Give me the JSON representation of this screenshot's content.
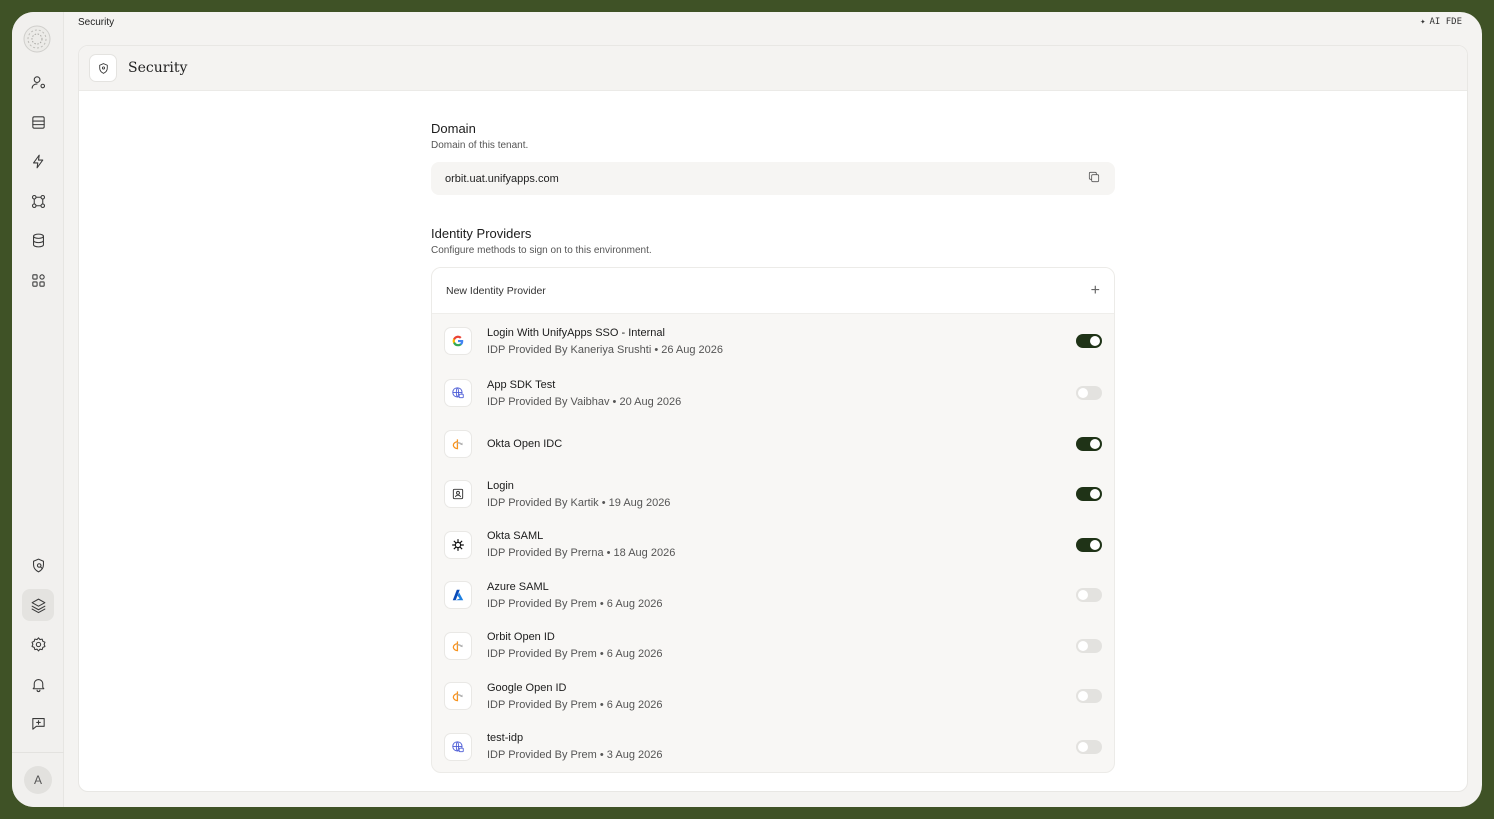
{
  "window": {
    "breadcrumb": "Security",
    "ai_label": "AI FDE"
  },
  "page": {
    "title": "Security"
  },
  "domain": {
    "title": "Domain",
    "subtitle": "Domain of this tenant.",
    "value": "orbit.uat.unifyapps.com"
  },
  "identity_providers": {
    "title": "Identity Providers",
    "subtitle": "Configure methods to sign on to this environment.",
    "new_label": "New Identity Provider",
    "items": [
      {
        "name": "Login With UnifyApps SSO - Internal",
        "meta": "IDP Provided By Kaneriya Srushti • 26 Aug 2026",
        "icon": "google-icon",
        "enabled": true
      },
      {
        "name": "App SDK Test",
        "meta": "IDP Provided By Vaibhav • 20 Aug 2026",
        "icon": "globe-icon",
        "enabled": false
      },
      {
        "name": "Okta Open IDC",
        "meta": "",
        "icon": "openid-icon",
        "enabled": true
      },
      {
        "name": "Login",
        "meta": "IDP Provided By Kartik • 19 Aug 2026",
        "icon": "id-card-icon",
        "enabled": true
      },
      {
        "name": "Okta SAML",
        "meta": "IDP Provided By Prerna • 18 Aug 2026",
        "icon": "okta-icon",
        "enabled": true
      },
      {
        "name": "Azure SAML",
        "meta": "IDP Provided By Prem • 6 Aug 2026",
        "icon": "azure-icon",
        "enabled": false
      },
      {
        "name": "Orbit Open ID",
        "meta": "IDP Provided By Prem • 6 Aug 2026",
        "icon": "openid-icon",
        "enabled": false
      },
      {
        "name": "Google Open ID",
        "meta": "IDP Provided By Prem • 6 Aug 2026",
        "icon": "openid-icon",
        "enabled": false
      },
      {
        "name": "test-idp",
        "meta": "IDP Provided By Prem • 3 Aug 2026",
        "icon": "globe-icon",
        "enabled": false
      }
    ]
  },
  "sidebar": {
    "avatar_initial": "A"
  },
  "colors": {
    "frame_border": "#3f5226",
    "toggle_on": "#1f3317",
    "toggle_off": "#e3e2df"
  }
}
